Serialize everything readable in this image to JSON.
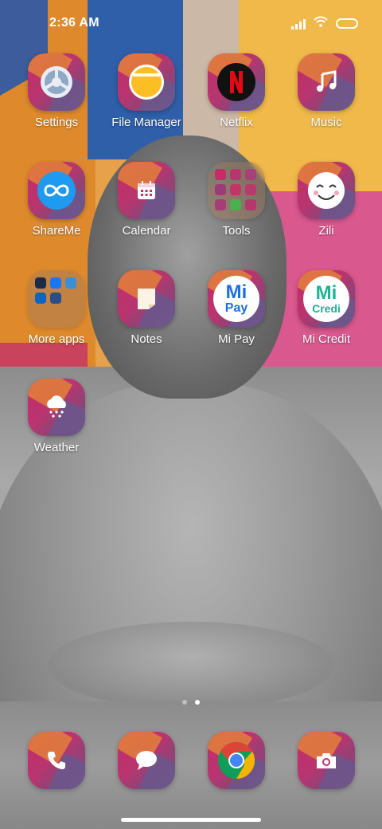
{
  "status_bar": {
    "time": "2:36 AM",
    "icons": [
      "signal-icon",
      "wifi-icon",
      "battery-icon"
    ]
  },
  "apps": {
    "settings": {
      "label": "Settings",
      "icon": "settings-gear-icon"
    },
    "file_manager": {
      "label": "File Manager",
      "icon": "folder-icon"
    },
    "netflix": {
      "label": "Netflix",
      "icon": "netflix-n-icon"
    },
    "music": {
      "label": "Music",
      "icon": "music-note-icon"
    },
    "shareme": {
      "label": "ShareMe",
      "icon": "infinity-icon"
    },
    "calendar": {
      "label": "Calendar",
      "icon": "calendar-icon"
    },
    "tools": {
      "label": "Tools",
      "icon": "folder-grid-icon"
    },
    "zili": {
      "label": "Zili",
      "icon": "smiley-face-icon"
    },
    "more_apps": {
      "label": "More apps",
      "icon": "folder-grid-icon"
    },
    "notes": {
      "label": "Notes",
      "icon": "note-page-icon"
    },
    "mi_pay": {
      "label": "Mi Pay",
      "icon": "mi-pay-icon",
      "logo_text_top": "Mi",
      "logo_text_bottom": "Pay"
    },
    "mi_credit": {
      "label": "Mi Credit",
      "icon": "mi-credit-icon",
      "logo_text_top": "Mi",
      "logo_text_bottom": "Credi"
    },
    "weather": {
      "label": "Weather",
      "icon": "cloud-snow-icon"
    }
  },
  "dock": [
    {
      "name": "phone",
      "icon": "phone-icon"
    },
    {
      "name": "messages",
      "icon": "message-bubble-icon"
    },
    {
      "name": "chrome",
      "icon": "chrome-icon"
    },
    {
      "name": "camera",
      "icon": "camera-icon"
    }
  ],
  "pages": {
    "count": 2,
    "active_index": 1
  },
  "colors": {
    "icon_magenta": "#c52c68",
    "icon_orange": "#e2803b",
    "icon_purple": "#6c568c",
    "netflix_red": "#e50914",
    "chrome_red": "#db4437",
    "chrome_yellow": "#f4b400",
    "chrome_green": "#0f9d58",
    "chrome_blue": "#4285f4"
  }
}
